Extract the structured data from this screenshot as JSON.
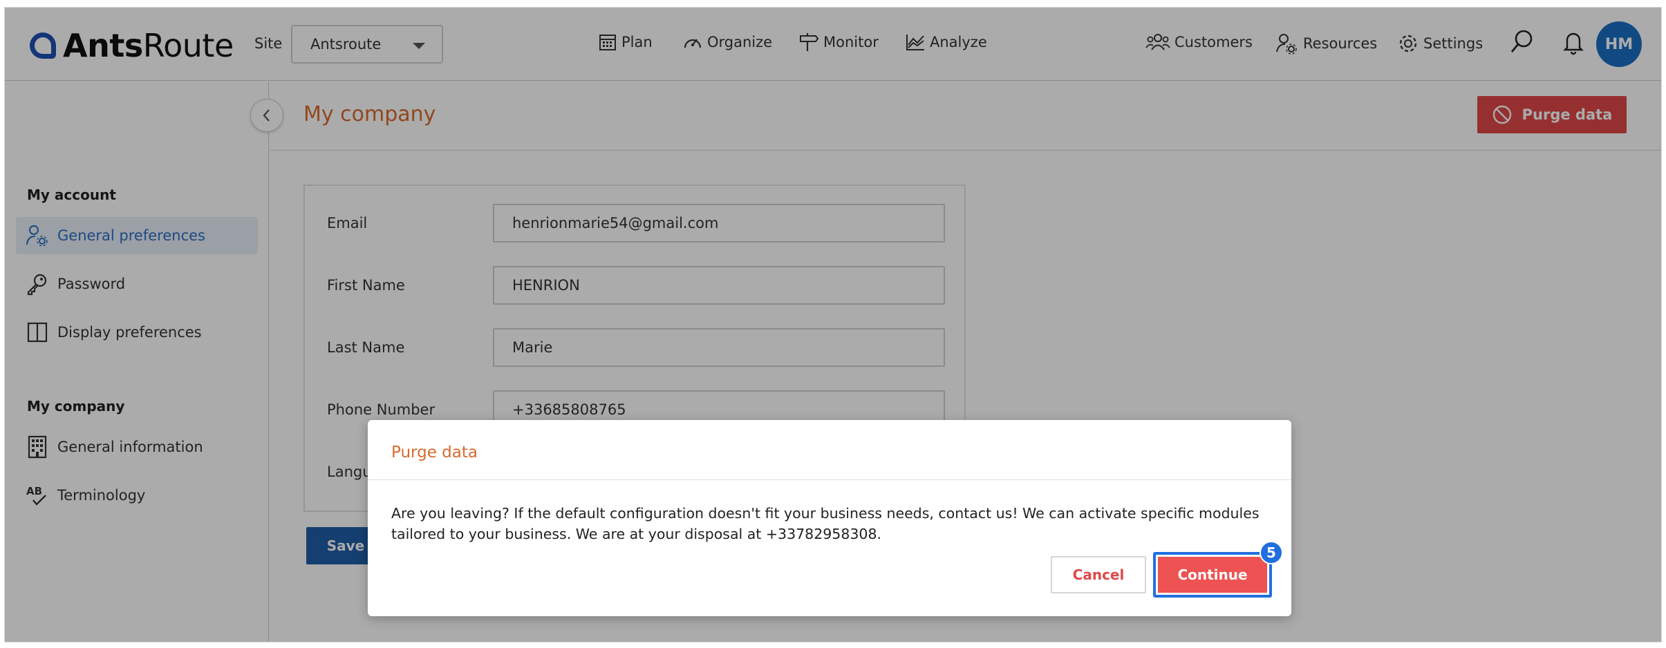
{
  "brand": {
    "logo_bold": "Ants",
    "logo_light": "Route"
  },
  "header": {
    "site_label": "Site",
    "site_value": "Antsroute",
    "nav": [
      "Plan",
      "Organize",
      "Monitor",
      "Analyze"
    ],
    "right_nav": [
      "Customers",
      "Resources",
      "Settings"
    ],
    "avatar_initials": "HM"
  },
  "sidebar": {
    "section_account": "My account",
    "account_items": [
      "General preferences",
      "Password",
      "Display preferences"
    ],
    "section_company": "My company",
    "company_items": [
      "General information",
      "Terminology"
    ]
  },
  "main": {
    "title": "My company",
    "purge_label": "Purge data",
    "save_label": "Save",
    "form": {
      "email_label": "Email",
      "email_value": "henrionmarie54@gmail.com",
      "first_label": "First Name",
      "first_value": "HENRION",
      "last_label": "Last Name",
      "last_value": "Marie",
      "phone_label": "Phone Number",
      "phone_value": "+33685808765",
      "lang_label": "Langu"
    }
  },
  "modal": {
    "title": "Purge data",
    "body": "Are you leaving? If the default configuration doesn't fit your business needs, contact us! We can activate specific modules tailored to your business. We are at your disposal at +33782958308.",
    "cancel": "Cancel",
    "continue": "Continue",
    "step_badge": "5"
  },
  "colors": {
    "accent_orange": "#d86b2e",
    "danger": "#e04848",
    "primary_blue": "#1f5ea8",
    "highlight": "#1f6fe0"
  }
}
